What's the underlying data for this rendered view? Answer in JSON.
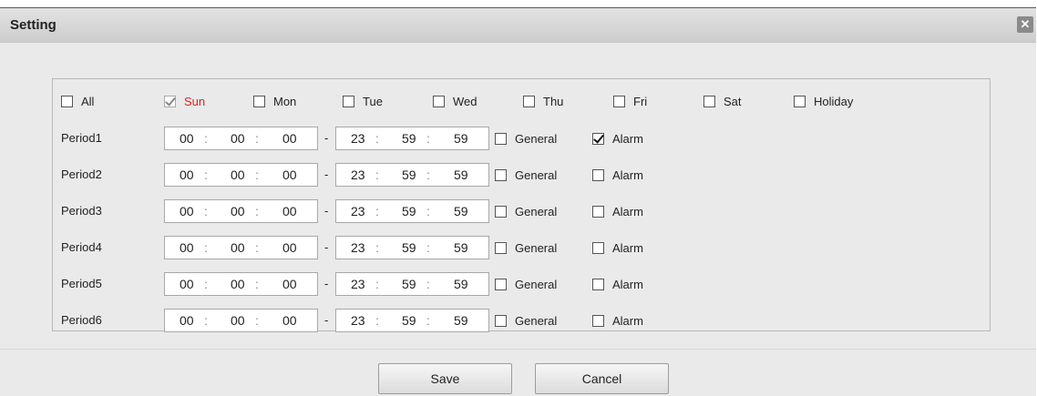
{
  "dialog": {
    "title": "Setting",
    "close_symbol": "✕"
  },
  "days": [
    {
      "label": "All",
      "checked": false
    },
    {
      "label": "Sun",
      "checked": true
    },
    {
      "label": "Mon",
      "checked": false
    },
    {
      "label": "Tue",
      "checked": false
    },
    {
      "label": "Wed",
      "checked": false
    },
    {
      "label": "Thu",
      "checked": false
    },
    {
      "label": "Fri",
      "checked": false
    },
    {
      "label": "Sat",
      "checked": false
    },
    {
      "label": "Holiday",
      "checked": false
    }
  ],
  "periods": [
    {
      "label": "Period1",
      "start": [
        "00",
        "00",
        "00"
      ],
      "end": [
        "23",
        "59",
        "59"
      ],
      "general": false,
      "alarm": true
    },
    {
      "label": "Period2",
      "start": [
        "00",
        "00",
        "00"
      ],
      "end": [
        "23",
        "59",
        "59"
      ],
      "general": false,
      "alarm": false
    },
    {
      "label": "Period3",
      "start": [
        "00",
        "00",
        "00"
      ],
      "end": [
        "23",
        "59",
        "59"
      ],
      "general": false,
      "alarm": false
    },
    {
      "label": "Period4",
      "start": [
        "00",
        "00",
        "00"
      ],
      "end": [
        "23",
        "59",
        "59"
      ],
      "general": false,
      "alarm": false
    },
    {
      "label": "Period5",
      "start": [
        "00",
        "00",
        "00"
      ],
      "end": [
        "23",
        "59",
        "59"
      ],
      "general": false,
      "alarm": false
    },
    {
      "label": "Period6",
      "start": [
        "00",
        "00",
        "00"
      ],
      "end": [
        "23",
        "59",
        "59"
      ],
      "general": false,
      "alarm": false
    }
  ],
  "labels": {
    "time_sep": ":",
    "range_dash": "-",
    "general": "General",
    "alarm": "Alarm"
  },
  "buttons": {
    "save": "Save",
    "cancel": "Cancel"
  },
  "colors": {
    "active_day": "#e02020"
  }
}
